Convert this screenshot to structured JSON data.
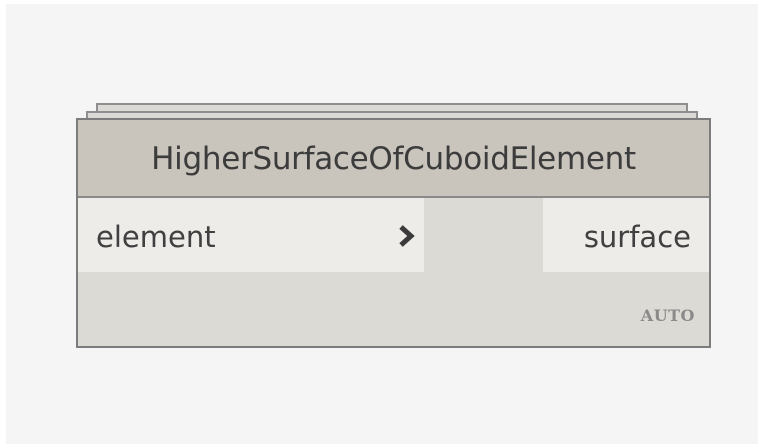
{
  "node": {
    "title": "HigherSurfaceOfCuboidElement",
    "input_port": {
      "label": "element",
      "icon": "chevron-right-icon"
    },
    "output_port": {
      "label": "surface"
    },
    "lacing": "AUTO"
  },
  "colors": {
    "canvas_background": "#f5f5f5",
    "node_header": "#c9c4bc",
    "node_body": "#dcdad4",
    "port_background": "#eeece8",
    "border": "#7c7c7c"
  }
}
